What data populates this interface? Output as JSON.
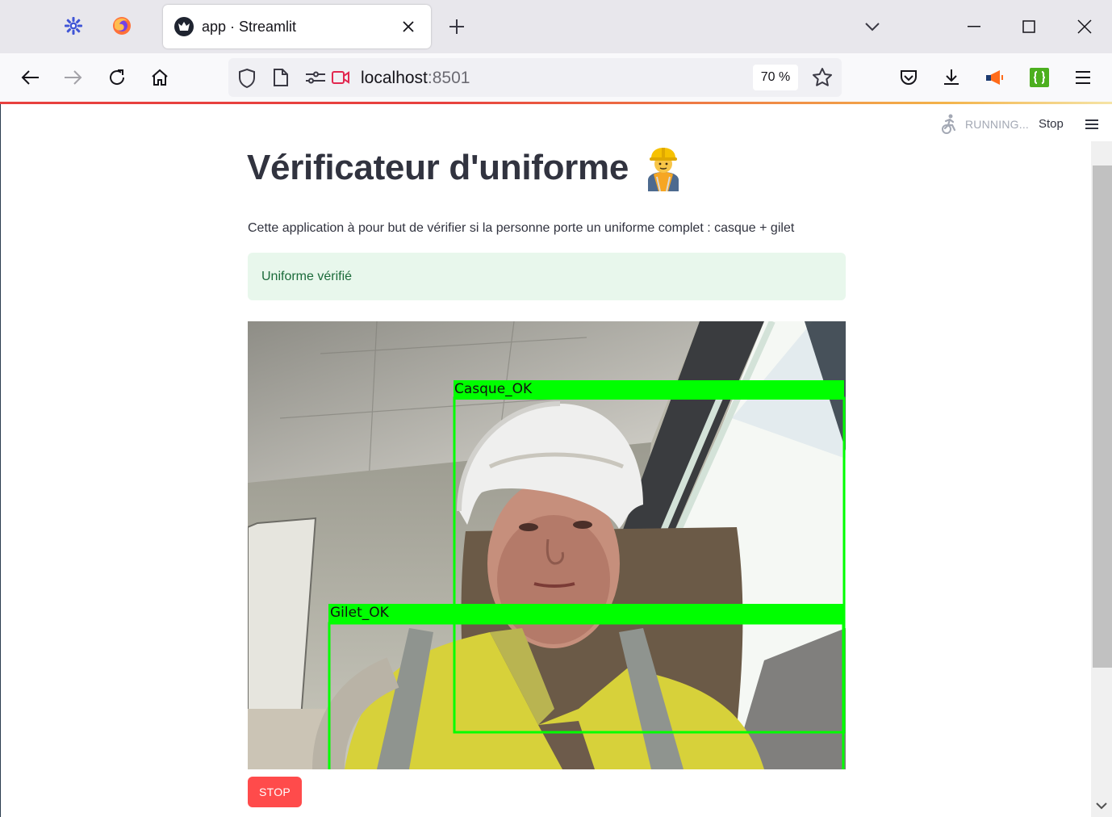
{
  "browser": {
    "tab_title": "app · Streamlit",
    "url_host": "localhost",
    "url_port": ":8501",
    "zoom": "70 %"
  },
  "streamlit": {
    "status": "RUNNING...",
    "stop_link": "Stop"
  },
  "app": {
    "title": "Vérificateur d'uniforme",
    "description": "Cette application à pour but de vérifier si la personne porte un uniforme complet : casque + gilet",
    "alert": "Uniforme vérifié",
    "stop_button": "STOP"
  },
  "detections": {
    "helmet_label": "Casque_OK",
    "vest_label": "Gilet_OK",
    "box_color": "#00ff00"
  },
  "colors": {
    "accent": "#ff4b4b",
    "success_bg": "#e8f7ec",
    "success_text": "#1b6b3a"
  }
}
